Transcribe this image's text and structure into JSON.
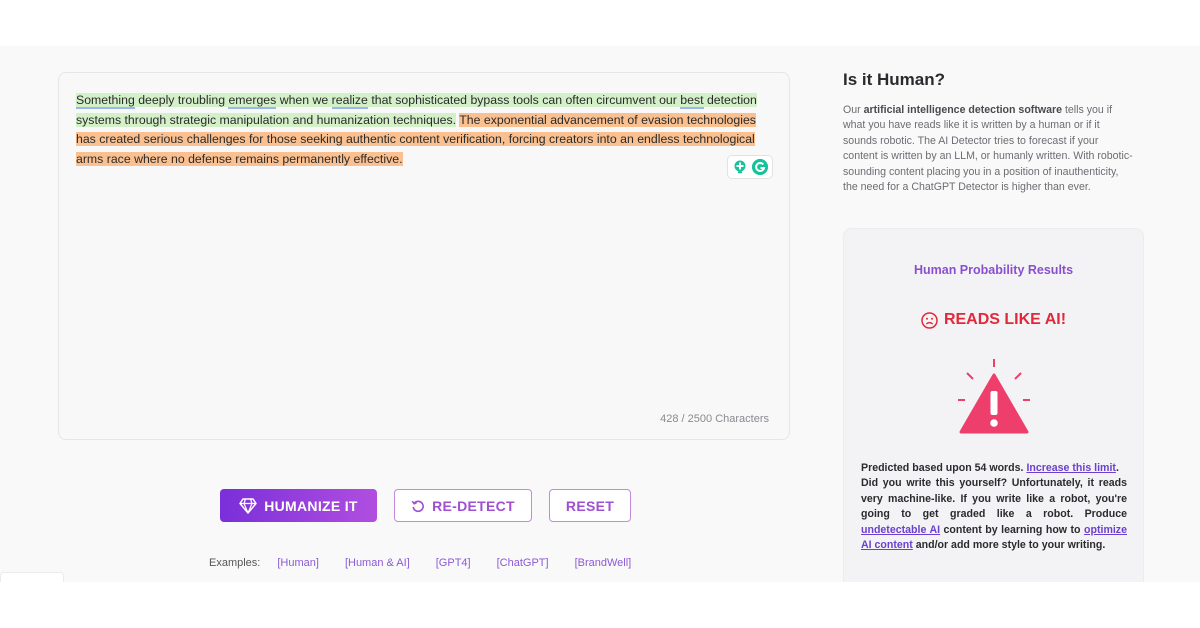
{
  "editor": {
    "segments": [
      {
        "text": "Something",
        "hl": "green",
        "underline": true
      },
      {
        "text": " deeply troubling ",
        "hl": "green"
      },
      {
        "text": "emerges",
        "hl": "green",
        "underline": true
      },
      {
        "text": " when we ",
        "hl": "green"
      },
      {
        "text": "realize",
        "hl": "green",
        "underline": true
      },
      {
        "text": " that sophisticated bypass tools can often circumvent our ",
        "hl": "green"
      },
      {
        "text": "best",
        "hl": "green",
        "underline": true
      },
      {
        "text": " detection systems through strategic manipulation and humanization techniques.",
        "hl": "green"
      },
      {
        "text": " ",
        "hl": ""
      },
      {
        "text": "The exponential advancement of evasion technologies has created serious challenges for those seeking authentic content verification, forcing creators into an endless technological arms race where no defense remains permanently effective.",
        "hl": "orange"
      }
    ],
    "char_count": "428 / 2500 Characters"
  },
  "buttons": {
    "humanize": "HUMANIZE IT",
    "redetect": "RE-DETECT",
    "reset": "RESET"
  },
  "examples": {
    "label": "Examples:",
    "links": [
      "[Human]",
      "[Human & AI]",
      "[GPT4]",
      "[ChatGPT]",
      "[BrandWell]"
    ]
  },
  "sidebar": {
    "title": "Is it Human?",
    "desc_prefix": "Our ",
    "desc_bold": "artificial intelligence detection software",
    "desc_rest": " tells you if what you have reads like it is written by a human or if it sounds robotic. The AI Detector tries to forecast if your content is written by an LLM, or humanly written. With robotic-sounding content placing you in a position of inauthenticity, the need for a ChatGPT Detector is higher than ever."
  },
  "result": {
    "heading": "Human Probability Results",
    "verdict": "READS LIKE AI!",
    "predicted_prefix": "Predicted based upon ",
    "word_count": "54 words.",
    "increase_link": "Increase this limit",
    "period": ".",
    "body_1": "Did you write this yourself? Unfortunately, it reads very machine-like. If you write like a robot, you're going to get graded like a robot. Produce ",
    "undetectable_link": "undetectable AI",
    "body_2": " content by learning how to ",
    "optimize_link": "optimize AI content",
    "body_3": " and/or add more style to your writing."
  },
  "colors": {
    "accent_purple": "#8a4fd0",
    "verdict_red": "#e0293a",
    "warning_pink": "#ee3f6c",
    "highlight_green": "#d3f0c9",
    "highlight_orange": "#fbc08f"
  }
}
